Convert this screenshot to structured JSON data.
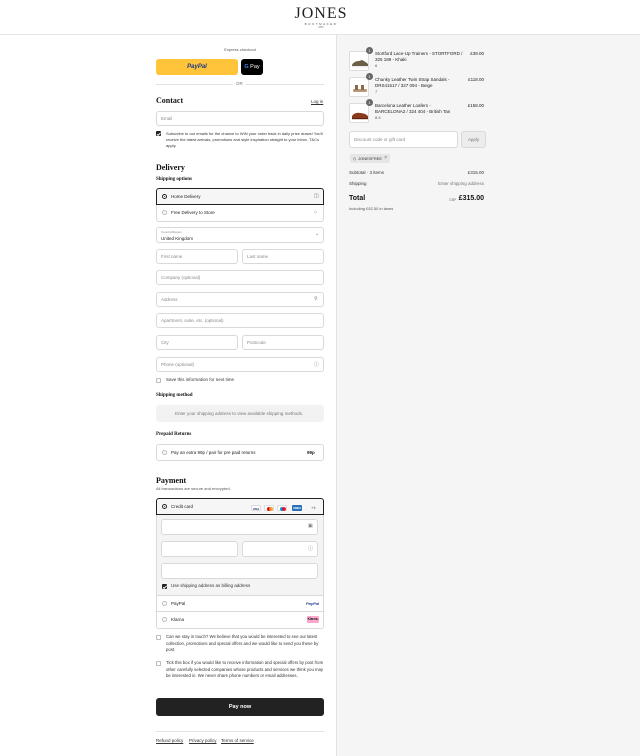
{
  "brand": {
    "name": "JONES",
    "sub": "BOOTMAKER",
    "tiny": "1857"
  },
  "express": {
    "label": "Express checkout",
    "paypal": "PayPal",
    "gpay_g": "G",
    "gpay": "Pay",
    "or": "OR"
  },
  "contact": {
    "title": "Contact",
    "login": "Log in",
    "email_placeholder": "Email",
    "subscribe_text": "Subscribe to our emails for the chance to WIN your order back in daily prize draws! You'll receive the latest arrivals, promotions and style inspiration straight to your inbox. T&Cs apply."
  },
  "delivery": {
    "title": "Delivery",
    "shipping_options_title": "Shipping options",
    "option_home": "Home Delivery",
    "option_store": "Free Delivery to Store",
    "country_label": "Country/Region",
    "country_value": "United Kingdom",
    "first_name": "First name",
    "last_name": "Last name",
    "company": "Company (optional)",
    "address": "Address",
    "apartment": "Apartment, suite, etc. (optional)",
    "city": "City",
    "postcode": "Postcode",
    "phone": "Phone (optional)",
    "save_info": "Save this information for next time"
  },
  "shipping_method": {
    "title": "Shipping method",
    "message": "Enter your shipping address to view available shipping methods."
  },
  "returns": {
    "title": "Prepaid Returns",
    "option": "Pay an extra 99p / pair for pre paid returns",
    "price": "99p"
  },
  "payment": {
    "title": "Payment",
    "subtitle": "All transactions are secure and encrypted.",
    "credit_card": "Credit card",
    "cards": [
      "VISA",
      "MC",
      "MAE",
      "AMEX"
    ],
    "more": "+4",
    "billing_same": "Use shipping address as billing address",
    "paypal": "PayPal",
    "paypal_logo": "PayPal",
    "klarna": "Klarna",
    "klarna_logo": "Klarna."
  },
  "consent": {
    "stay_in_touch": "Can we stay in touch? We believe that you would be interested to see our latest collection, promotions and special offers and we would like to send you these by post.",
    "third_party": "Tick this box if you would like to receive information and special offers by post from other carefully selected companies whose products and services we think you may be interested in. We never share phone numbers or email addresses."
  },
  "pay_now": "Pay now",
  "footer": {
    "refund": "Refund policy",
    "privacy": "Privacy policy",
    "terms": "Terms of service"
  },
  "cart": {
    "items": [
      {
        "qty": "1",
        "name": "Stortford Lace-Up Trainers - STORTFORD / 325 189 - Khaki",
        "size": "6",
        "price": "£39.00",
        "color": "#6b6045"
      },
      {
        "qty": "1",
        "name": "Chunky Leather Twin Strap Sandals - DRS41517 / 327 094 - Beige",
        "size": "7",
        "price": "£118.00",
        "color": "#b89a7a"
      },
      {
        "qty": "1",
        "name": "Barcelona Leather Loafers - BARCELONA2 / 324 404 - British Tan",
        "size": "8.5",
        "price": "£158.00",
        "color": "#8a3a1c"
      }
    ],
    "discount_placeholder": "Discount code or gift card",
    "apply": "Apply",
    "code": "JONESFREE",
    "subtotal_label": "Subtotal · 3 items",
    "subtotal": "£315.00",
    "shipping_label": "Shipping",
    "shipping_value": "Enter shipping address",
    "total_label": "Total",
    "currency": "GBP",
    "total": "£315.00",
    "taxes": "Including £52.50 in taxes"
  },
  "colors": {
    "paypal_yellow": "#ffc439",
    "dark": "#222222",
    "klarna_pink": "#ffa8cd",
    "amex": "#2671b9",
    "visa": "#1a1f71"
  }
}
